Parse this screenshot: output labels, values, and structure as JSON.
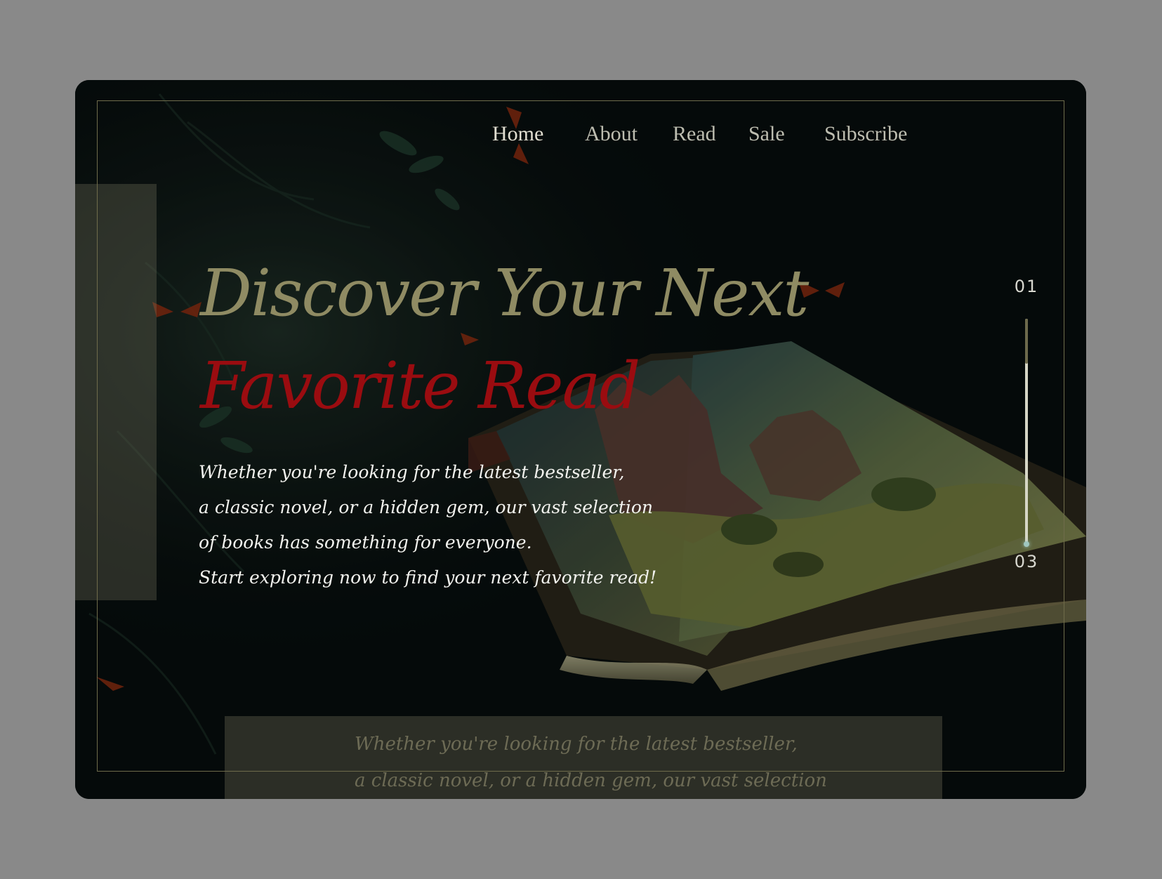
{
  "nav": {
    "items": [
      {
        "label": "Home"
      },
      {
        "label": "About"
      },
      {
        "label": "Read"
      },
      {
        "label": "Sale"
      },
      {
        "label": "Subscribe"
      }
    ]
  },
  "hero": {
    "title_line1": "Discover Your Next",
    "title_line2": "Favorite Read",
    "body_lines": [
      "Whether you're looking for the latest bestseller,",
      " a classic novel, or a hidden gem, our vast selection",
      "of books has something for everyone.",
      "Start exploring now to find your next favorite read!"
    ]
  },
  "pager": {
    "current": "01",
    "total": "03",
    "progress": 0.2
  },
  "bottom_card": {
    "lines": [
      "Whether you're looking for the latest bestseller,",
      "a classic novel, or a hidden gem, our vast selection"
    ]
  },
  "colors": {
    "background": "#898989",
    "card": "#050a0a",
    "title_olive": "#8f8b63",
    "title_red": "#9a0c10",
    "nav_text": "#bdbdb0"
  },
  "icons": [
    "open-book-illustration",
    "butterfly-icon"
  ]
}
